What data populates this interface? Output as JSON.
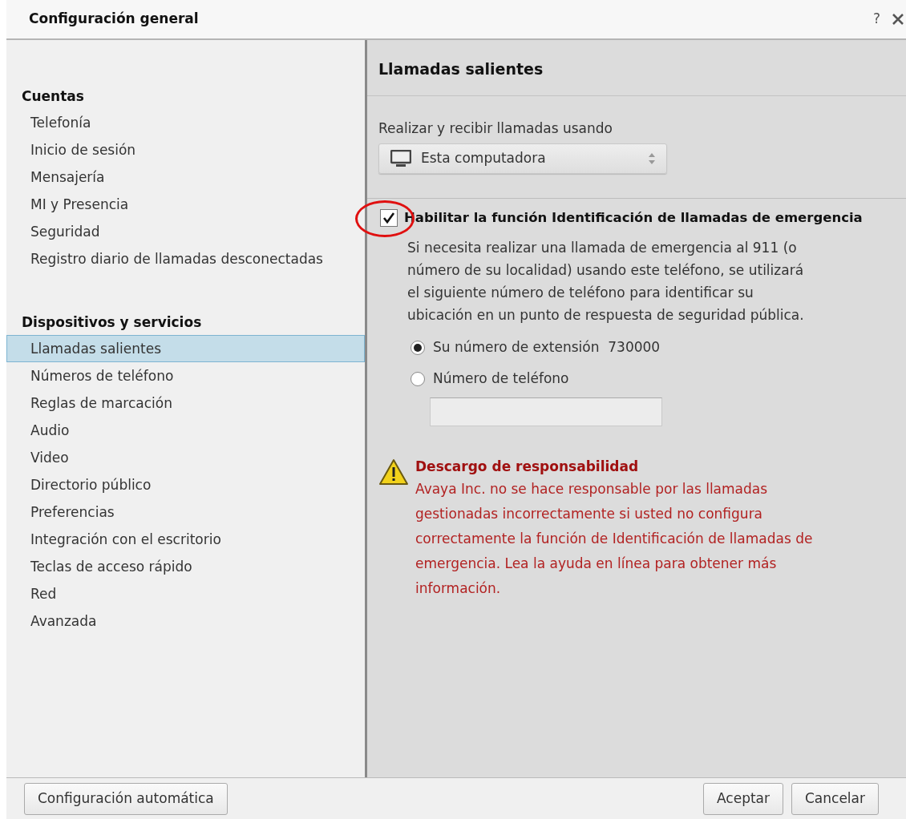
{
  "window": {
    "title": "Configuración general",
    "help": "?"
  },
  "sidebar": {
    "sections": [
      {
        "heading": "Cuentas",
        "items": [
          {
            "label": "Telefonía",
            "selected": false
          },
          {
            "label": "Inicio de sesión",
            "selected": false
          },
          {
            "label": "Mensajería",
            "selected": false
          },
          {
            "label": "MI y Presencia",
            "selected": false
          },
          {
            "label": "Seguridad",
            "selected": false
          },
          {
            "label": "Registro diario de llamadas desconectadas",
            "selected": false
          }
        ]
      },
      {
        "heading": "Dispositivos y servicios",
        "items": [
          {
            "label": "Llamadas salientes",
            "selected": true
          },
          {
            "label": "Números de teléfono",
            "selected": false
          },
          {
            "label": "Reglas de marcación",
            "selected": false
          },
          {
            "label": "Audio",
            "selected": false
          },
          {
            "label": "Video",
            "selected": false
          },
          {
            "label": "Directorio público",
            "selected": false
          },
          {
            "label": "Preferencias",
            "selected": false
          },
          {
            "label": "Integración con el escritorio",
            "selected": false
          },
          {
            "label": "Teclas de acceso rápido",
            "selected": false
          },
          {
            "label": "Red",
            "selected": false
          },
          {
            "label": "Avanzada",
            "selected": false
          }
        ]
      }
    ]
  },
  "panel": {
    "title": "Llamadas salientes",
    "device_label": "Realizar y recibir llamadas usando",
    "device_value": "Esta computadora",
    "emergency": {
      "label": "Habilitar la función Identificación de llamadas de emergencia",
      "checked": true,
      "description": "Si necesita realizar una llamada de emergencia al 911 (o número de su localidad) usando este teléfono, se utilizará el siguiente número de teléfono para identificar su ubicación en un punto de respuesta de seguridad pública.",
      "options": [
        {
          "label": "Su número de extensión  730000",
          "selected": true
        },
        {
          "label": "Número de teléfono",
          "selected": false
        }
      ]
    },
    "disclaimer": {
      "title": "Descargo de responsabilidad",
      "text": "Avaya Inc. no se hace responsable por las llamadas gestionadas incorrectamente si usted no configura correctamente la función de Identificación de llamadas de emergencia. Lea la ayuda en línea para obtener más información."
    }
  },
  "buttons": {
    "left": "Configuración automática",
    "ok": "Aceptar",
    "cancel": "Cancelar"
  }
}
